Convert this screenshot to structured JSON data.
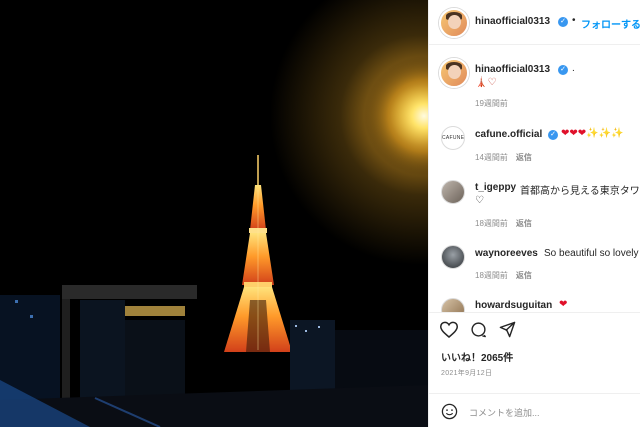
{
  "header": {
    "username": "hinaofficial0313",
    "separator": "•",
    "follow_label": "フォローする"
  },
  "caption": {
    "username": "hinaofficial0313",
    "text": ".",
    "emoji": "🗼♡",
    "time": "19週間前"
  },
  "comments": [
    {
      "username": "cafune.official",
      "avatar_text": "CAFUNE",
      "text": "❤❤❤✨✨✨",
      "time": "14週間前",
      "reply": "返信"
    },
    {
      "username": "t_igeppy",
      "text": "首都高から見える東京タワー",
      "text2": "♡",
      "time": "18週間前",
      "reply": "返信"
    },
    {
      "username": "waynoreeves",
      "text": "So beautiful so lovely",
      "time": "18週間前",
      "reply": "返信"
    },
    {
      "username": "howardsuguitan",
      "text": "❤"
    }
  ],
  "actions": {
    "like_icon": "heart-icon",
    "comment_icon": "comment-bubble-icon",
    "share_icon": "paper-plane-icon",
    "likes_text": "いいね！2065件",
    "date": "2021年9月12日"
  },
  "comment_box": {
    "emoji_icon": "smiley-icon",
    "placeholder": "コメントを追加..."
  },
  "colors": {
    "link": "#0095f6",
    "verified": "#3897f0",
    "tower_orange": "#ff7a1a",
    "lamp_glow": "#ffd23a"
  }
}
